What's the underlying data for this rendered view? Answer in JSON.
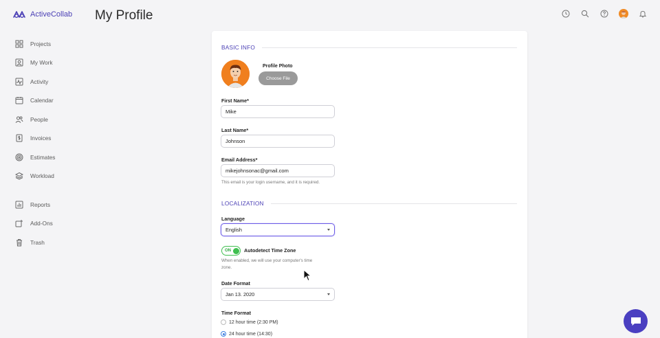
{
  "app": {
    "logo_text": "ActiveCollab",
    "page_title": "My Profile",
    "brand_color": "#4a3fb5"
  },
  "sidebar": {
    "items": [
      {
        "label": "Projects",
        "icon": "grid-icon"
      },
      {
        "label": "My Work",
        "icon": "person-card-icon"
      },
      {
        "label": "Activity",
        "icon": "activity-icon"
      },
      {
        "label": "Calendar",
        "icon": "calendar-icon"
      },
      {
        "label": "People",
        "icon": "people-icon"
      },
      {
        "label": "Invoices",
        "icon": "invoice-icon"
      },
      {
        "label": "Estimates",
        "icon": "target-icon"
      },
      {
        "label": "Workload",
        "icon": "layers-icon"
      },
      {
        "label": "Reports",
        "icon": "bar-chart-icon"
      },
      {
        "label": "Add-Ons",
        "icon": "add-on-icon"
      },
      {
        "label": "Trash",
        "icon": "trash-icon"
      }
    ]
  },
  "top_icons": [
    "clock-icon",
    "search-icon",
    "help-icon",
    "user-avatar",
    "bell-icon"
  ],
  "basic_info": {
    "heading": "BASIC INFO",
    "photo_label": "Profile Photo",
    "choose_file": "Choose File",
    "first_name_label": "First Name*",
    "first_name": "Mike",
    "last_name_label": "Last Name*",
    "last_name": "Johnson",
    "email_label": "Email Address*",
    "email": "mikejohnsonac@gmail.com",
    "email_hint": "This email is your login username, and it is required."
  },
  "localization": {
    "heading": "LOCALIZATION",
    "language_label": "Language",
    "language": "English",
    "toggle_state": "ON",
    "autodetect_label": "Autodetect Time Zone",
    "autodetect_hint_1": "When enabled, we will use your computer's time",
    "autodetect_hint_2": "zone.",
    "date_format_label": "Date Format",
    "date_format": "Jan 13. 2020",
    "time_format_label": "Time Format",
    "time_options": [
      {
        "label": "12 hour time (2:30 PM)",
        "selected": false
      },
      {
        "label": "24 hour time (14:30)",
        "selected": true
      }
    ]
  }
}
